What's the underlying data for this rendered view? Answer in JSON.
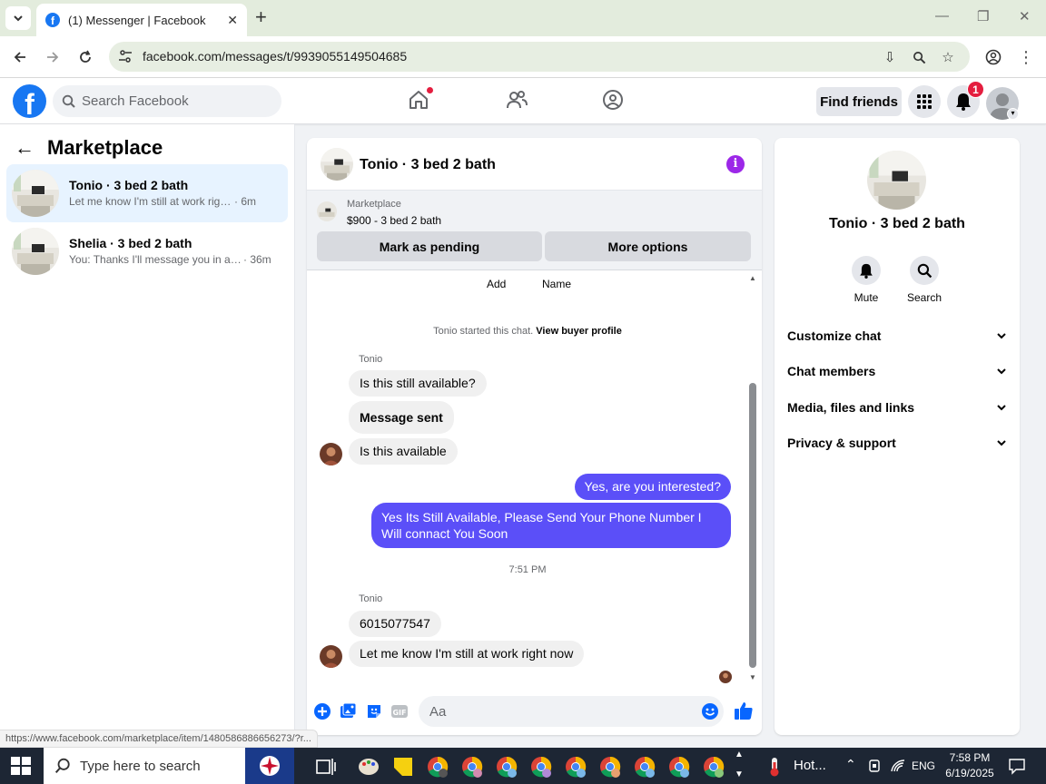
{
  "browser": {
    "tab_title": "(1) Messenger | Facebook",
    "url": "facebook.com/messages/t/9939055149504685"
  },
  "fbnav": {
    "search_placeholder": "Search Facebook",
    "find_friends": "Find friends",
    "notification_count": "1"
  },
  "sidebar": {
    "title": "Marketplace",
    "conversations": [
      {
        "name": "Tonio · 3 bed 2 bath",
        "preview": "Let me know I'm still at work right now",
        "time": "· 6m",
        "active": true
      },
      {
        "name": "Shelia · 3 bed 2 bath",
        "preview": "You: Thanks I'll message you in a m...",
        "time": "· 36m",
        "active": false
      }
    ]
  },
  "chat": {
    "title": "Tonio · 3 bed 2 bath",
    "listing": {
      "label": "Marketplace",
      "price": "$900 - 3 bed 2 bath",
      "pending_button": "Mark as pending",
      "options_button": "More options"
    },
    "top_actions": [
      "Add",
      "Name"
    ],
    "system_text": "Tonio started this chat.",
    "system_link": "View buyer profile",
    "sender_name": "Tonio",
    "messages_block1": [
      {
        "text": "Is this still available?"
      },
      {
        "text": "Message sent"
      },
      {
        "text": "Is this available"
      }
    ],
    "outgoing": [
      {
        "text": "Yes, are you interested?"
      },
      {
        "text": "Yes Its Still Available, Please Send Your Phone Number I Will connact You Soon"
      }
    ],
    "timestamp": "7:51 PM",
    "messages_block2": [
      {
        "text": "6015077547"
      },
      {
        "text": "Let me know I'm still at work right now"
      }
    ],
    "composer_placeholder": "Aa"
  },
  "info_panel": {
    "name": "Tonio · 3 bed 2 bath",
    "actions": [
      "Mute",
      "Search"
    ],
    "sections": [
      "Customize chat",
      "Chat members",
      "Media, files and links",
      "Privacy & support"
    ]
  },
  "status_url": "https://www.facebook.com/marketplace/item/1480586886656273/?r...",
  "taskbar": {
    "search_placeholder": "Type here to search",
    "weather": "Hot...",
    "language": "ENG",
    "time": "7:58 PM",
    "date": "6/19/2025"
  },
  "colors": {
    "facebook_blue": "#1877f2",
    "outgoing_bubble": "#5b4ff8",
    "info_purple": "#9c27e8",
    "notification_red": "#e41e3f"
  }
}
